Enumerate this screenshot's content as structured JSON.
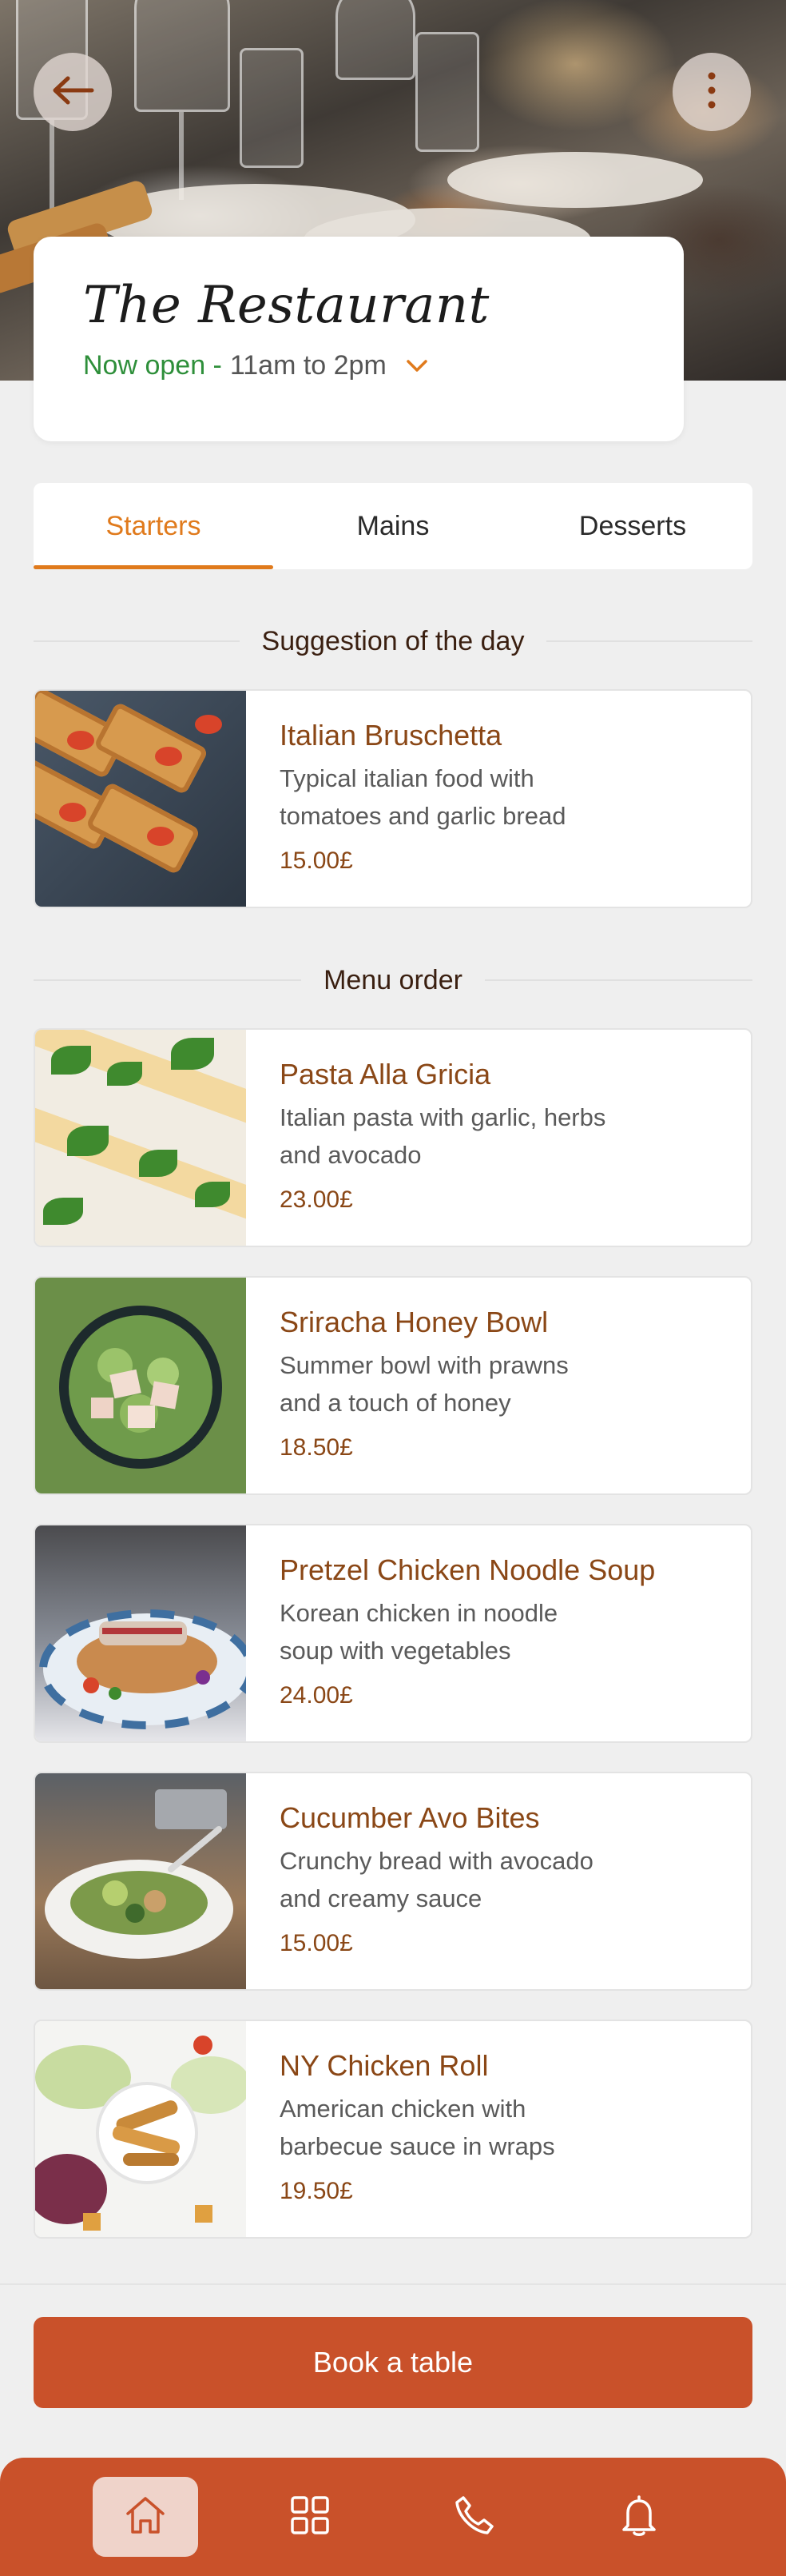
{
  "restaurant": {
    "name": "The Restaurant",
    "open_status": "Now open -",
    "hours": "11am to 2pm"
  },
  "tabs": [
    {
      "label": "Starters",
      "active": true
    },
    {
      "label": "Mains",
      "active": false
    },
    {
      "label": "Desserts",
      "active": false
    }
  ],
  "suggestion": {
    "heading": "Suggestion of the day",
    "item": {
      "name": "Italian Bruschetta",
      "desc": "Typical italian food with tomatoes and garlic bread",
      "price": "15.00£"
    }
  },
  "menu": {
    "heading": "Menu order",
    "items": [
      {
        "name": "Pasta Alla Gricia",
        "desc": "Italian pasta with garlic, herbs and avocado",
        "price": "23.00£"
      },
      {
        "name": "Sriracha Honey Bowl",
        "desc": "Summer bowl with prawns and a touch of honey",
        "price": "18.50£"
      },
      {
        "name": "Pretzel Chicken Noodle Soup",
        "desc": "Korean chicken in noodle soup with vegetables",
        "price": "24.00£"
      },
      {
        "name": "Cucumber Avo Bites",
        "desc": "Crunchy bread with avocado and creamy sauce",
        "price": "15.00£"
      },
      {
        "name": "NY Chicken Roll",
        "desc": "American chicken with barbecue sauce in wraps",
        "price": "19.50£"
      }
    ]
  },
  "cta": {
    "book_label": "Book a table"
  },
  "nav": [
    {
      "icon": "home-icon",
      "active": true
    },
    {
      "icon": "grid-icon",
      "active": false
    },
    {
      "icon": "phone-icon",
      "active": false
    },
    {
      "icon": "bell-icon",
      "active": false
    }
  ],
  "colors": {
    "accent": "#c9512a",
    "tab_active": "#e07a1c",
    "open_green": "#2e8f3a",
    "item_title": "#8a4716"
  }
}
